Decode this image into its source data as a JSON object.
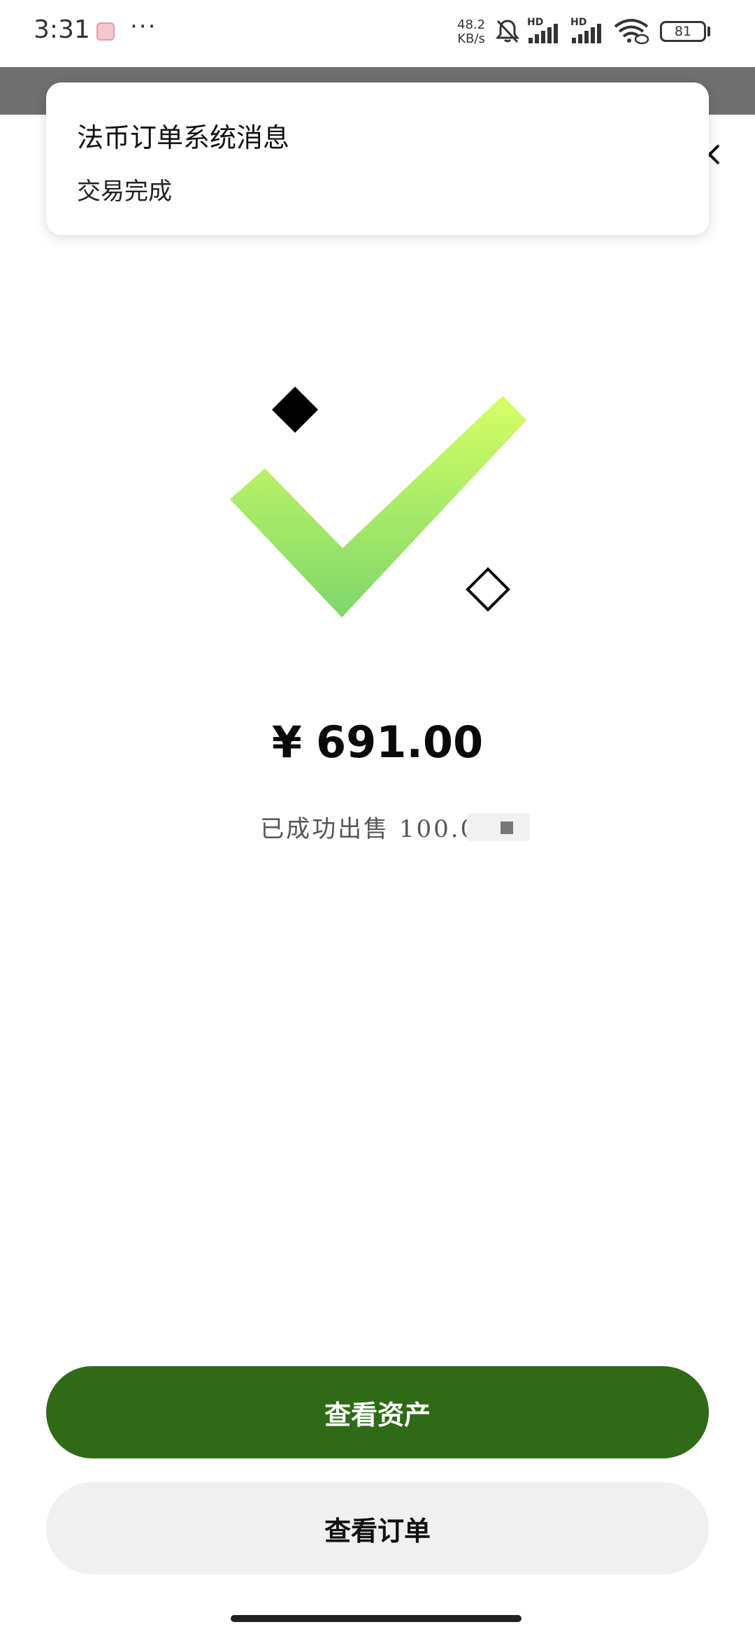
{
  "status_bar": {
    "time": "3:31",
    "more": "···",
    "net_speed_value": "48.2",
    "net_speed_unit": "KB/s",
    "signal_1_label": "HD",
    "signal_2_label": "HD",
    "battery_level": "81"
  },
  "notification": {
    "title": "法币订单系统消息",
    "body": "交易完成"
  },
  "result": {
    "currency_symbol": "¥",
    "amount": "691.00",
    "sold_text": "已成功出售 100.00"
  },
  "buttons": {
    "view_assets": "查看资产",
    "view_orders": "查看订单"
  },
  "colors": {
    "primary_button": "#2f6a17",
    "secondary_button": "#f0f0f0",
    "check_gradient_top": "#d6ff66",
    "check_gradient_bottom": "#7ed66a",
    "header_band": "#6f6f6f"
  }
}
